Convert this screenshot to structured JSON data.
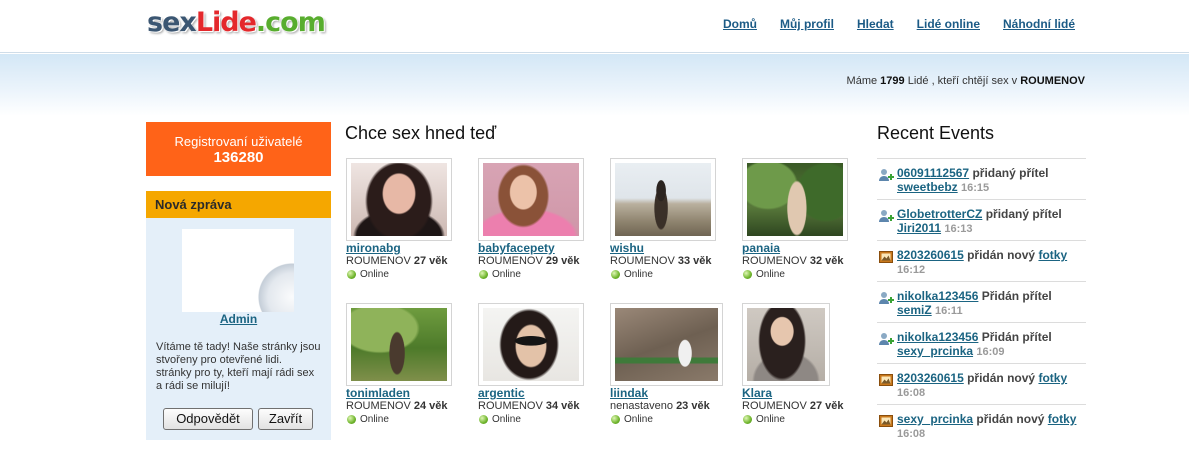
{
  "logo": {
    "part1": "sex",
    "part2": "Lide",
    "part3": ".com"
  },
  "nav": {
    "items": [
      {
        "label": "Domů"
      },
      {
        "label": "Můj profil"
      },
      {
        "label": "Hledat"
      },
      {
        "label": "Lidé online"
      },
      {
        "label": "Náhodní lidé"
      }
    ]
  },
  "banner": {
    "prefix": "Máme",
    "count": "1799",
    "middle": "Lidé , kteří chtějí sex v",
    "city": "ROUMENOV"
  },
  "sidebar": {
    "registered": {
      "label": "Registrovaní uživatelé",
      "count": "136280"
    },
    "message": {
      "title": "Nová zpráva",
      "sender": "Admin",
      "lines": [
        "Vítáme tě tady! Naše stránky jsou",
        "stvořeny pro otevřené lidi.",
        "stránky pro ty, kteří mají rádi sex",
        "a rádi se milují!"
      ],
      "reply_label": "Odpovědět",
      "close_label": "Zavřít"
    }
  },
  "main": {
    "title": "Chce sex hned teď",
    "profiles": [
      {
        "name": "mironabg",
        "location": "ROUMENOV",
        "age": "27 věk",
        "status": "Online"
      },
      {
        "name": "babyfacepety",
        "location": "ROUMENOV",
        "age": "29 věk",
        "status": "Online"
      },
      {
        "name": "wishu",
        "location": "ROUMENOV",
        "age": "33 věk",
        "status": "Online"
      },
      {
        "name": "panaia",
        "location": "ROUMENOV",
        "age": "32 věk",
        "status": "Online"
      },
      {
        "name": "tonimladen",
        "location": "ROUMENOV",
        "age": "24 věk",
        "status": "Online"
      },
      {
        "name": "argentic",
        "location": "ROUMENOV",
        "age": "34 věk",
        "status": "Online"
      },
      {
        "name": "liindak",
        "location": "nenastaveno",
        "age": "23 věk",
        "status": "Online"
      },
      {
        "name": "Klara",
        "location": "ROUMENOV",
        "age": "27 věk",
        "status": "Online"
      }
    ]
  },
  "events": {
    "title": "Recent Events",
    "items": [
      {
        "icon": "friend-add-icon",
        "user": "06091112567",
        "action": "přidaný přítel",
        "target": "sweetbebz",
        "time": "16:15"
      },
      {
        "icon": "friend-add-icon",
        "user": "GlobetrotterCZ",
        "action": "přidaný přítel",
        "target": "Jiri2011",
        "time": "16:13"
      },
      {
        "icon": "photo-icon",
        "user": "8203260615",
        "action": "přidán nový",
        "target": "fotky",
        "time": "16:12"
      },
      {
        "icon": "friend-add-icon",
        "user": "nikolka123456",
        "action": "Přidán přítel",
        "target": "semiZ",
        "time": "16:11"
      },
      {
        "icon": "friend-add-icon",
        "user": "nikolka123456",
        "action": "Přidán přítel",
        "target": "sexy_prcinka",
        "time": "16:09"
      },
      {
        "icon": "photo-icon",
        "user": "8203260615",
        "action": "přidán nový",
        "target": "fotky",
        "time": "16:08"
      },
      {
        "icon": "photo-icon",
        "user": "sexy_prcinka",
        "action": "přidán nový",
        "target": "fotky",
        "time": "16:08"
      }
    ]
  },
  "colors": {
    "link": "#1b6482",
    "registered_bg": "#ff6318",
    "message_header_bg": "#f5a700",
    "message_body_bg": "#e4eff9",
    "online": "#6fb52c"
  }
}
